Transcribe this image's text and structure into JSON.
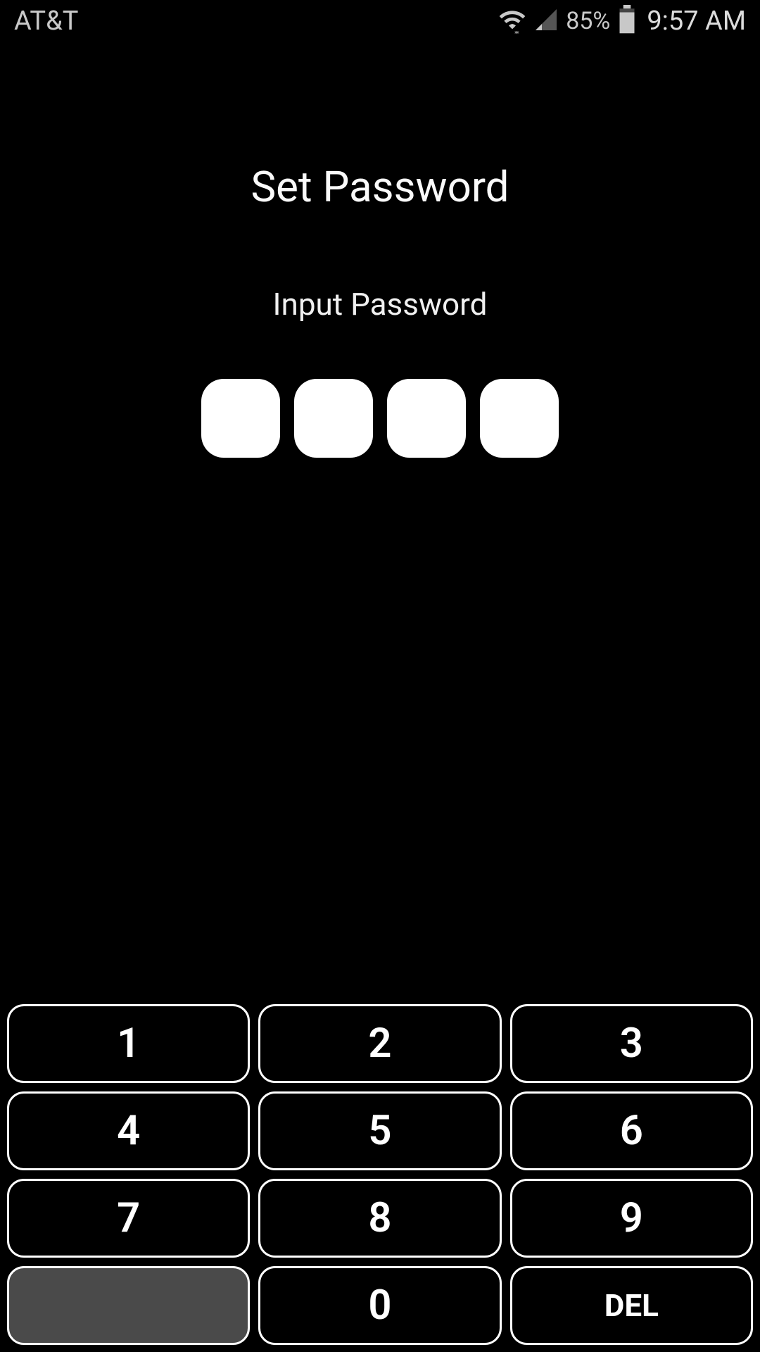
{
  "status_bar": {
    "carrier": "AT&T",
    "battery_pct": "85%",
    "time": "9:57 AM"
  },
  "screen": {
    "title": "Set Password",
    "subtitle": "Input Password"
  },
  "keypad": {
    "k1": "1",
    "k2": "2",
    "k3": "3",
    "k4": "4",
    "k5": "5",
    "k6": "6",
    "k7": "7",
    "k8": "8",
    "k9": "9",
    "k0": "0",
    "del": "DEL"
  }
}
